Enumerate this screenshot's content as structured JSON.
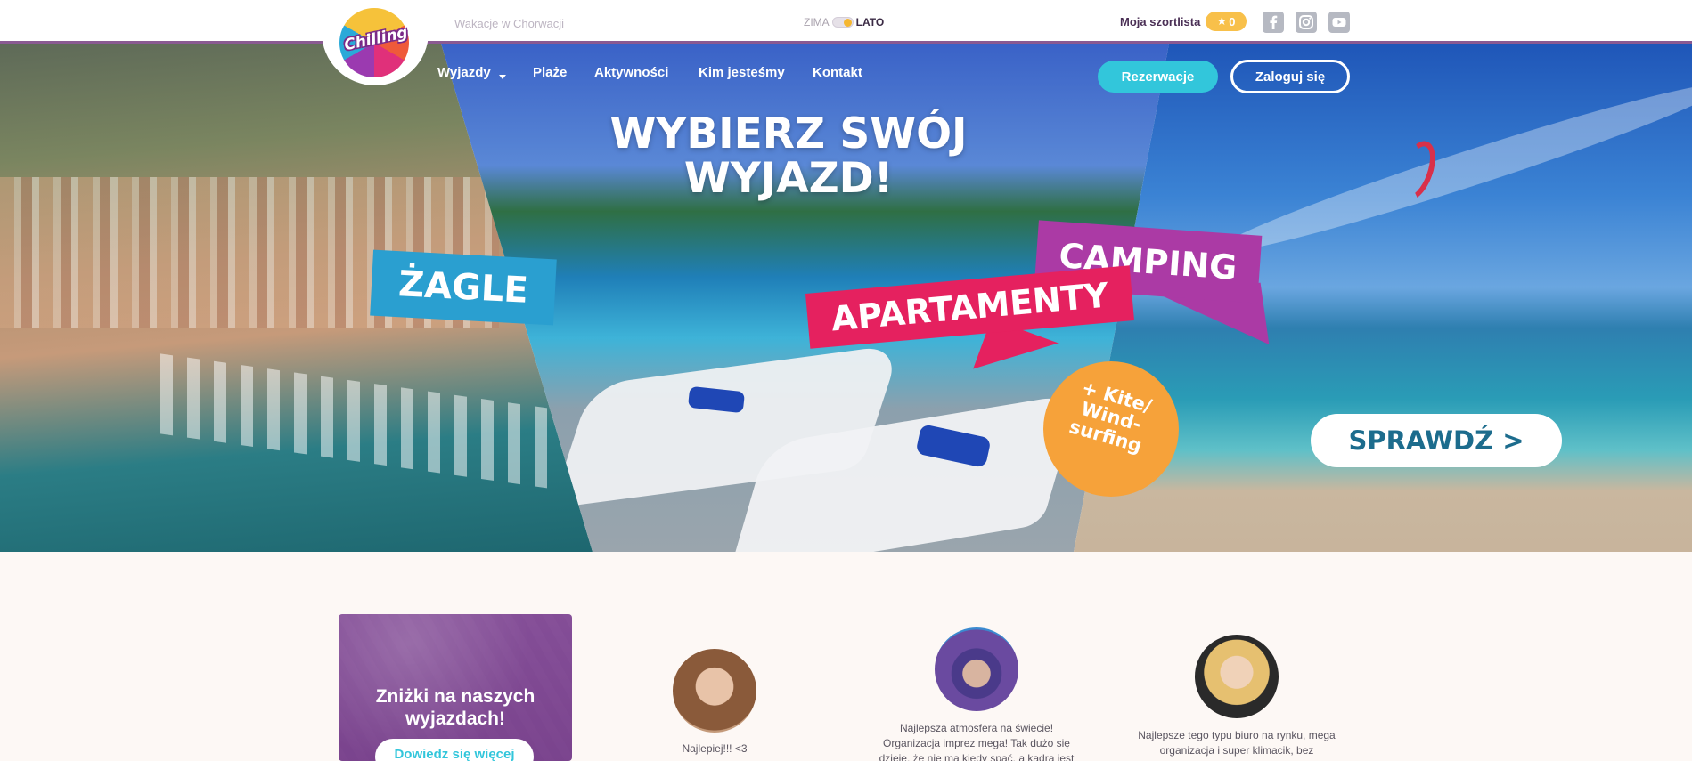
{
  "header": {
    "logo_text": "Chilling",
    "tagline": "Wakacje w Chorwacji",
    "season": {
      "winter": "ZIMA",
      "summer": "LATO"
    },
    "shortlist_label": "Moja szortlista",
    "shortlist_count": "0",
    "social": [
      "facebook-icon",
      "instagram-icon",
      "youtube-icon"
    ]
  },
  "nav": {
    "items": [
      "Wyjazdy",
      "Plaże",
      "Aktywności",
      "Kim jesteśmy",
      "Kontakt"
    ],
    "reservation": "Rezerwacje",
    "login": "Zaloguj się"
  },
  "hero": {
    "title": "WYBIERZ SWÓJ WYJAZD!",
    "tag_sailing": "ŻAGLE",
    "tag_apartments": "APARTAMENTY",
    "tag_camping": "CAMPING",
    "kite_badge": "+ Kite/ Wind- surfing",
    "cta": "SPRAWDŹ >"
  },
  "promo": {
    "title": "Zniżki na naszych wyjazdach!",
    "button": "Dowiedz się więcej"
  },
  "testimonials": [
    {
      "text": "Najlepiej!!! <3"
    },
    {
      "text": "Najlepsza atmosfera na świecie! Organizacja imprez mega! Tak dużo się dzieje, że nie ma kiedy spać, a kadra jest"
    },
    {
      "text": "Najlepsze tego typu biuro na rynku, mega organizacja i super klimacik, bez"
    }
  ],
  "colors": {
    "accent": "#32c6db",
    "brand_purple": "#8a5a92",
    "star_badge": "#f8c04a",
    "pink": "#e5215f",
    "magenta": "#ab3aa5",
    "blue_tag": "#2a9fd0",
    "orange": "#f6a23a"
  }
}
